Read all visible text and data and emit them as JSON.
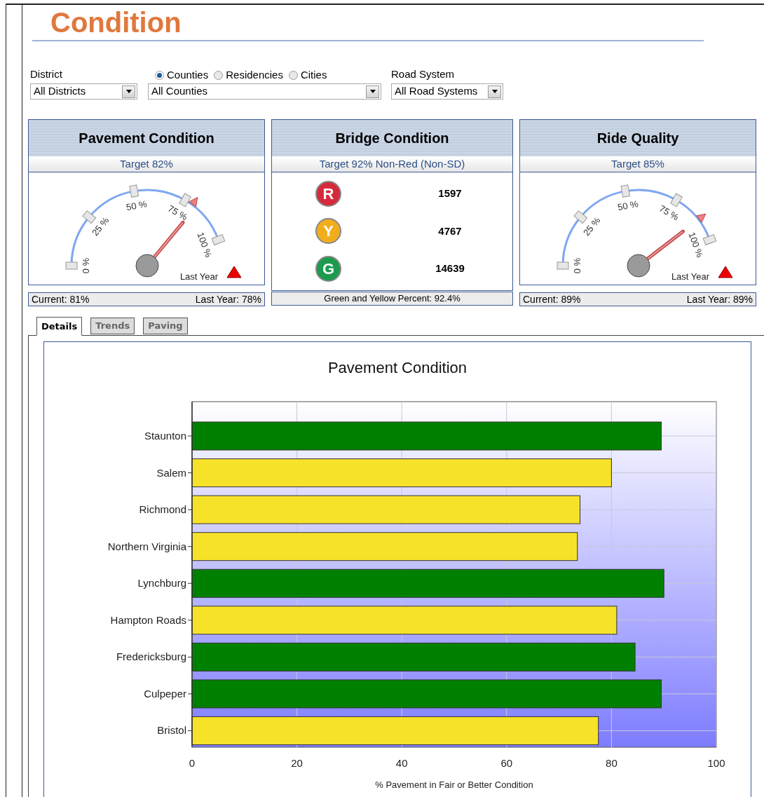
{
  "header": {
    "title": "Condition"
  },
  "filters": {
    "district": {
      "label": "District",
      "value": "All Districts"
    },
    "area_type": [
      {
        "label": "Counties",
        "selected": true
      },
      {
        "label": "Residencies",
        "selected": false
      },
      {
        "label": "Cities",
        "selected": false
      }
    ],
    "area": {
      "value": "All Counties"
    },
    "road_system": {
      "label": "Road System",
      "value": "All Road Systems"
    }
  },
  "panels": [
    {
      "kind": "gauge",
      "title": "Pavement Condition",
      "target": "Target 82%",
      "gauge": {
        "ticks": [
          "0 %",
          "25 %",
          "50 %",
          "75 %",
          "100 %"
        ],
        "legend": "Last Year"
      },
      "footer": {
        "current": "Current: 81%",
        "last_year": "Last Year: 78%"
      }
    },
    {
      "kind": "bridge",
      "title": "Bridge Condition",
      "target": "Target 92% Non-Red (Non-SD)",
      "ratings": [
        {
          "letter": "R",
          "color": "#d42a3c",
          "count": "1597"
        },
        {
          "letter": "Y",
          "color": "#f2ad1c",
          "count": "4767"
        },
        {
          "letter": "G",
          "color": "#1c9a4e",
          "count": "14639"
        }
      ],
      "footer": {
        "summary": "Green and Yellow Percent: 92.4%"
      }
    },
    {
      "kind": "gauge",
      "title": "Ride Quality",
      "target": "Target 85%",
      "gauge": {
        "ticks": [
          "0 %",
          "25 %",
          "50 %",
          "75 %",
          "100 %"
        ],
        "legend": "Last Year"
      },
      "footer": {
        "current": "Current: 89%",
        "last_year": "Last Year: 89%"
      }
    }
  ],
  "tabs": [
    {
      "label": "Details",
      "selected": true
    },
    {
      "label": "Trends",
      "selected": false
    },
    {
      "label": "Paving",
      "selected": false
    }
  ],
  "chart_data": {
    "type": "bar",
    "orientation": "horizontal",
    "title": "Pavement Condition",
    "xlabel": "% Pavement in Fair or Better Condition",
    "categories": [
      "Staunton",
      "Salem",
      "Richmond",
      "Northern Virginia",
      "Lynchburg",
      "Hampton Roads",
      "Fredericksburg",
      "Culpeper",
      "Bristol"
    ],
    "values": [
      89.5,
      80,
      74,
      73.5,
      90,
      81,
      84.5,
      89.5,
      77.5
    ],
    "colors": [
      "#008000",
      "#f7e22a",
      "#f7e22a",
      "#f7e22a",
      "#008000",
      "#f7e22a",
      "#008000",
      "#008000",
      "#f7e22a"
    ],
    "xlim": [
      0,
      100
    ],
    "xticks": [
      0,
      20,
      40,
      60,
      80,
      100
    ],
    "grid": true
  }
}
